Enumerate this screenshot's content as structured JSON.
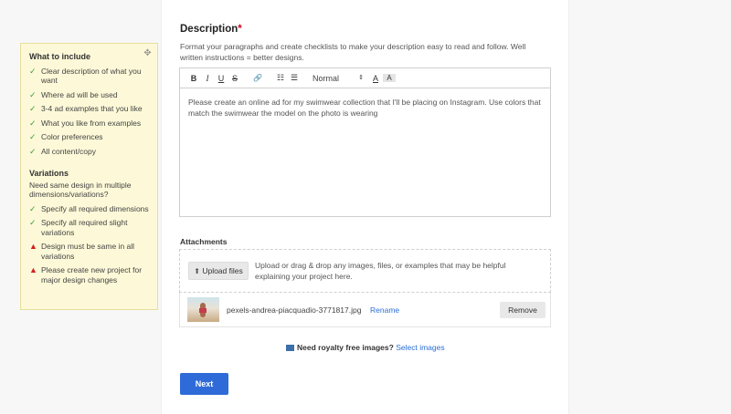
{
  "tips": {
    "include_heading": "What to include",
    "include_items": [
      "Clear description of what you want",
      "Where ad will be used",
      "3-4 ad examples that you like",
      "What you like from examples",
      "Color preferences",
      "All content/copy"
    ],
    "variations_heading": "Variations",
    "variations_sub": "Need same design in multiple dimensions/variations?",
    "variations_checks": [
      "Specify all required dimensions",
      "Specify all required slight variations"
    ],
    "variations_warnings": [
      "Design must be same in all variations",
      "Please create new project for major design changes"
    ]
  },
  "description": {
    "title": "Description",
    "required_mark": "*",
    "help": "Format your paragraphs and create checklists to make your description easy to read and follow. Well written instructions = better designs.",
    "toolbar": {
      "bold": "B",
      "italic": "I",
      "underline": "U",
      "strike": "S",
      "link": "🔗",
      "ordered_list": "☷",
      "bullet_list": "☰",
      "format_select": "Normal",
      "font_color": "A",
      "highlight": "A"
    },
    "body": "Please create an online ad for my swimwear collection that I'll be placing on Instagram. Use colors that match the swimwear the model on the photo is wearing"
  },
  "attachments": {
    "title": "Attachments",
    "upload_label": "Upload files",
    "drop_text": "Upload or drag & drop any images, files, or examples that may be helpful explaining your project here.",
    "file": {
      "name": "pexels-andrea-piacquadio-3771817.jpg",
      "rename": "Rename",
      "remove": "Remove"
    }
  },
  "royalty": {
    "question": "Need royalty free images?",
    "link": "Select images"
  },
  "next_label": "Next"
}
